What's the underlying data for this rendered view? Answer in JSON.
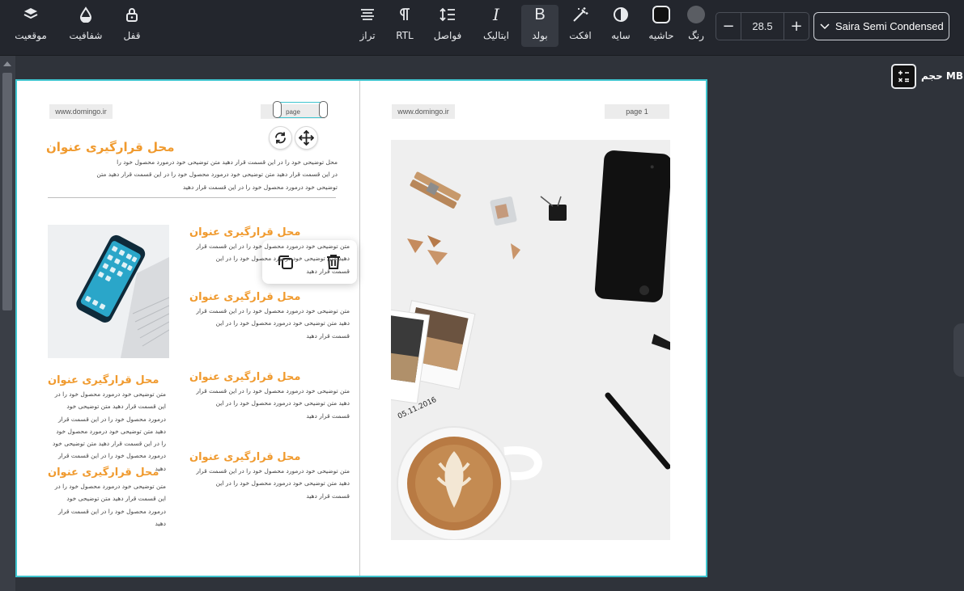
{
  "toolbar": {
    "position_label": "موقعیت",
    "opacity_label": "شفافیت",
    "lock_label": "قفل",
    "align_label": "تراز",
    "rtl_label": "RTL",
    "spacing_label": "فواصل",
    "italic_label": "ایتالیک",
    "bold_label": "بولد",
    "effect_label": "افکت",
    "shadow_label": "سایه",
    "border_label": "حاشیه",
    "color_label": "رنگ",
    "font_size": "28.5",
    "font_family": "Saira Semi Condensed",
    "bold_glyph": "B",
    "italic_glyph": "I",
    "minus_glyph": "−",
    "plus_glyph": "+"
  },
  "side": {
    "size_label": "حجم MB"
  },
  "canvas": {
    "left_page": {
      "website": "www.domingo.ir",
      "page_chip": "page",
      "header_title": "محل قرارگیری عنوان",
      "header_text": [
        "محل توضیحی خود را در این قسمت قرار دهید  متن توضیحی خود درمورد محصول خود را",
        "در این قسمت قرار دهید  متن توضیحی خود درمورد محصول خود را در این قسمت قرار دهید  متن",
        "توضیحی خود درمورد محصول خود را در این قسمت قرار دهید"
      ],
      "right_column": [
        {
          "title": "محل قرارگیری عنوان",
          "lines": [
            "متن توضیحی خود درمورد محصول خود را در این قسمت قرار",
            "دهید  متن توضیحی خود درمورد محصول خود را در این",
            "قسمت قرار دهید"
          ]
        },
        {
          "title": "محل قرارگیری عنوان",
          "lines": [
            "متن توضیحی خود درمورد محصول خود را در این قسمت قرار",
            "دهید  متن توضیحی خود درمورد محصول خود را در این",
            "قسمت قرار دهید"
          ]
        },
        {
          "title": "محل قرارگیری عنوان",
          "lines": [
            "متن توضیحی خود درمورد محصول خود را در این قسمت قرار",
            "دهید  متن توضیحی خود درمورد محصول خود را در این",
            "قسمت قرار دهید"
          ]
        },
        {
          "title": "محل قرارگیری عنوان",
          "lines": [
            "متن توضیحی خود درمورد محصول خود را در این قسمت قرار",
            "دهید  متن توضیحی خود درمورد محصول خود را در این",
            "قسمت قرار دهید"
          ]
        }
      ],
      "left_column": [
        {
          "title": "محل قرارگیری عنوان",
          "lines": [
            "متن توضیحی خود درمورد محصول خود را در",
            "این قسمت قرار دهید  متن توضیحی خود",
            "درمورد محصول خود را در این قسمت قرار",
            "دهید  متن توضیحی خود درمورد محصول خود",
            "را در این قسمت قرار دهید  متن توضیحی خود",
            "درمورد محصول خود را در این قسمت قرار",
            "دهید"
          ]
        },
        {
          "title": "محل قرارگیری عنوان",
          "lines": [
            "متن توضیحی خود درمورد محصول خود را در",
            "این قسمت قرار دهید  متن توضیحی خود",
            "درمورد محصول خود را در این قسمت قرار دهید"
          ]
        }
      ]
    },
    "right_page": {
      "website": "www.domingo.ir",
      "page_chip": "page 1",
      "photo_date": "05.11.2016"
    }
  },
  "colors": {
    "accent": "#3fc5cf",
    "title_orange": "#f09a2e",
    "toolbar_bg": "#23262d",
    "workspace_bg": "#2f333a"
  }
}
